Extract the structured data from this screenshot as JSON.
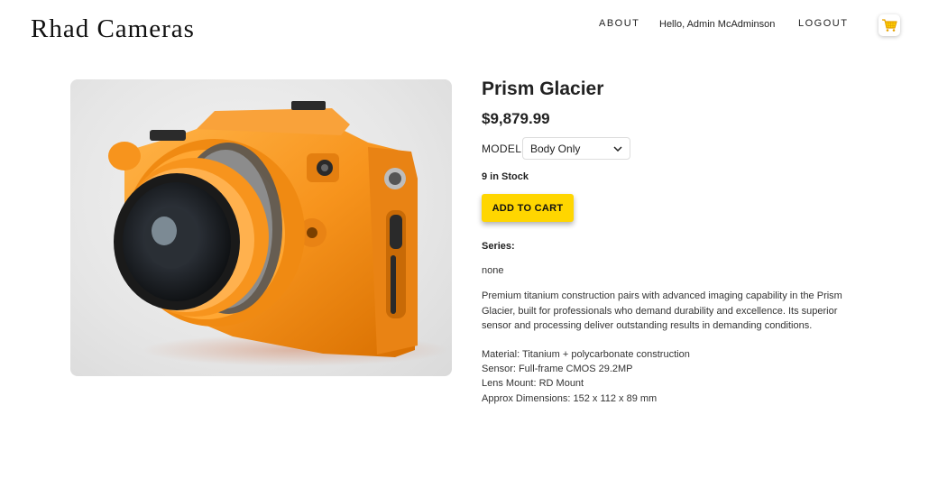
{
  "header": {
    "brand": "Rhad Cameras",
    "nav": {
      "about": "ABOUT",
      "greeting": "Hello, Admin McAdminson",
      "logout": "LOGOUT"
    },
    "cart_icon": "shopping-cart-icon"
  },
  "product": {
    "name": "Prism Glacier",
    "price": "$9,879.99",
    "image_subject": "orange camera",
    "model": {
      "label": "MODEL:",
      "selected": "Body Only"
    },
    "stock": "9 in Stock",
    "add_to_cart": "ADD TO CART",
    "series_label": "Series:",
    "series_value": "none",
    "description": "Premium titanium construction pairs with advanced imaging capability in the Prism Glacier, built for professionals who demand durability and excellence. Its superior sensor and processing deliver outstanding results in demanding conditions.",
    "specs": [
      "Material: Titanium + polycarbonate construction",
      "Sensor: Full-frame CMOS 29.2MP",
      "Lens Mount: RD Mount",
      "Approx Dimensions: 152 x 112 x 89 mm"
    ]
  },
  "colors": {
    "accent": "#ffd600",
    "camera_body": "#f7941d",
    "text": "#333333"
  }
}
